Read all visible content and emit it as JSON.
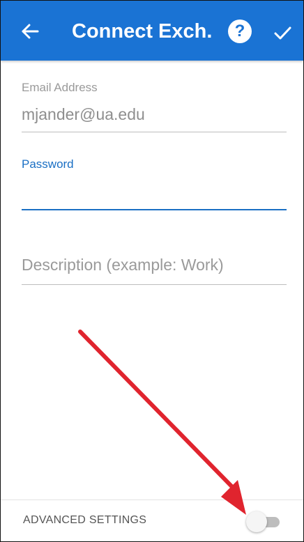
{
  "appbar": {
    "title": "Connect Exch...",
    "back_icon": "arrow-left-icon",
    "help_icon": "question-circle-icon",
    "help_glyph": "?",
    "confirm_icon": "checkmark-icon",
    "background_color": "#1a73d4"
  },
  "form": {
    "email": {
      "label": "Email Address",
      "value": "mjander@ua.edu"
    },
    "password": {
      "label": "Password",
      "value": ""
    },
    "description": {
      "placeholder": "Description (example: Work)"
    }
  },
  "advanced": {
    "label": "ADVANCED SETTINGS",
    "toggle_state": "off"
  },
  "annotation": {
    "arrow_color": "#e0242e"
  }
}
